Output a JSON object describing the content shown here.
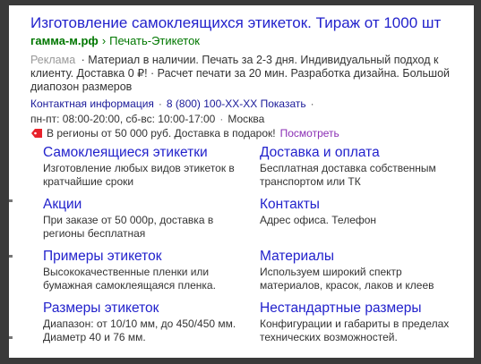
{
  "ad": {
    "title": "Изготовление самоклеящихся этикеток. Тираж от 1000 шт",
    "domain": "гамма-м.рф",
    "separator": "›",
    "path": "Печать-Этикеток",
    "ad_label": "Реклама",
    "ad_dot": "·",
    "description": "Материал в наличии. Печать за 2-3 дня. Индивидуальный подход к клиенту. Доставка 0 ₽! · Расчет печати за 20 мин. Разработка дизайна. Большой диапозон размеров",
    "contact_label": "Контактная информация",
    "contact_dot": "·",
    "phone": "8 (800) 100-ХХ-ХХ Показать",
    "phone_dot": "·",
    "hours": "пн-пт: 08:00-20:00, сб-вс: 10:00-17:00",
    "hours_dot": "·",
    "city": "Москва",
    "promo_text": "В регионы от 50 000 руб. Доставка в подарок!",
    "promo_more": "Посмотреть",
    "tag_color": "#e8222b"
  },
  "sitelinks": [
    {
      "title": "Самоклеящиеся этикетки",
      "desc": "Изготовление любых видов этикеток в кратчайшие сроки"
    },
    {
      "title": "Доставка и оплата",
      "desc": "Бесплатная доставка собственным транспортом или ТК"
    },
    {
      "title": "Акции",
      "desc": "При заказе от 50 000р, доставка в регионы бесплатная"
    },
    {
      "title": "Контакты",
      "desc": "Адрес офиса. Телефон"
    },
    {
      "title": "Примеры этикеток",
      "desc": "Высококачественные пленки или бумажная самоклеящаяся пленка."
    },
    {
      "title": "Материалы",
      "desc": "Используем широкий спектр материалов, красок, лаков и клеев"
    },
    {
      "title": "Размеры этикеток",
      "desc": "Диапазон: от 10/10 мм, до 450/450 мм. Диаметр 40 и 76 мм."
    },
    {
      "title": "Нестандартные размеры",
      "desc": "Конфигурации и габариты в пределах технических возможностей."
    }
  ],
  "colors": {
    "link": "#2222cc",
    "domain": "#007700",
    "visited": "#8b2fb5",
    "background": "#3a3a3a"
  }
}
